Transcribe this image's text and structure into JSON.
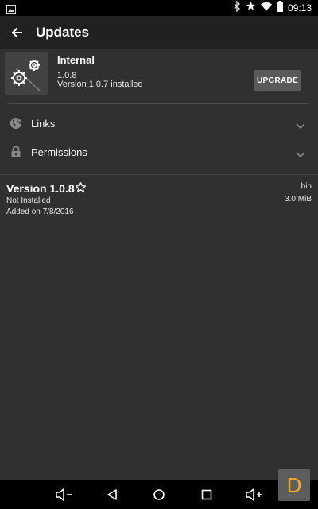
{
  "status_bar": {
    "time": "09:13",
    "icons": [
      "image-notification-icon",
      "bluetooth-icon",
      "star-icon",
      "wifi-icon",
      "battery-icon"
    ]
  },
  "app_bar": {
    "title": "Updates",
    "back_icon": "arrow-back-icon"
  },
  "app": {
    "name": "Internal",
    "version": "1.0.8",
    "installed": "Version 1.0.7 installed",
    "icon": "gears-icon",
    "upgrade_label": "UPGRADE"
  },
  "sections": [
    {
      "label": "Links",
      "icon": "globe-icon",
      "expanded": false
    },
    {
      "label": "Permissions",
      "icon": "lock-icon",
      "expanded": false
    }
  ],
  "version_entry": {
    "title": "Version 1.0.8",
    "status": "Not Installed",
    "added": "Added on 7/8/2016",
    "type": "bin",
    "size": "3.0 MiB"
  },
  "nav_bar": {
    "buttons": [
      "volume-down-icon",
      "back-icon",
      "home-icon",
      "recents-icon",
      "volume-up-icon"
    ]
  },
  "overlay_badge": {
    "letter": "D"
  },
  "colors": {
    "status_bar_bg": "#000000",
    "app_bar_bg": "#212121",
    "content_bg": "#303030",
    "button_bg": "#5a5a5a",
    "badge_bg": "#5d5d5d",
    "badge_letter": "#f5a623"
  }
}
